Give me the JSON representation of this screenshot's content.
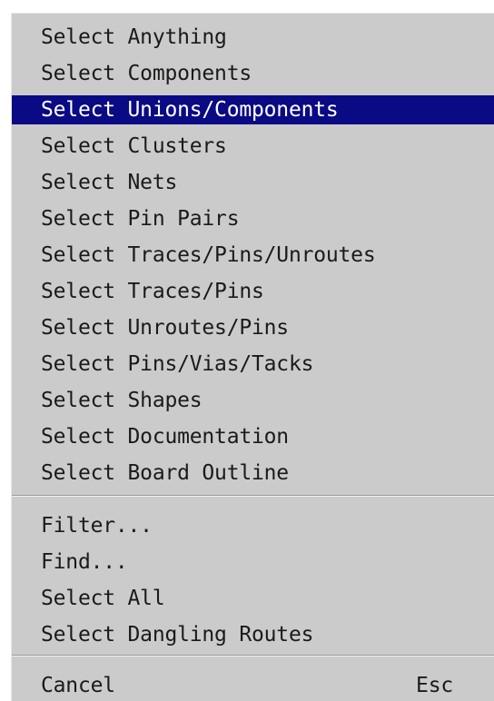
{
  "menu": {
    "items": [
      {
        "label": "Select Anything"
      },
      {
        "label": "Select Components"
      },
      {
        "label": "Select Unions/Components",
        "highlighted": true
      },
      {
        "label": "Select Clusters"
      },
      {
        "label": "Select Nets"
      },
      {
        "label": "Select Pin Pairs"
      },
      {
        "label": "Select Traces/Pins/Unroutes"
      },
      {
        "label": "Select Traces/Pins"
      },
      {
        "label": "Select Unroutes/Pins"
      },
      {
        "label": "Select Pins/Vias/Tacks"
      },
      {
        "label": "Select Shapes"
      },
      {
        "label": "Select Documentation"
      },
      {
        "label": "Select Board Outline"
      },
      {
        "label": "Filter..."
      },
      {
        "label": "Find..."
      },
      {
        "label": "Select All"
      },
      {
        "label": "Select Dangling Routes"
      },
      {
        "label": "Cancel",
        "shortcut": "Esc"
      }
    ],
    "colors": {
      "background": "#cbcbcb",
      "highlight": "#0a0a84",
      "highlight_text": "#ffffff",
      "text": "#1a1a1a"
    }
  }
}
